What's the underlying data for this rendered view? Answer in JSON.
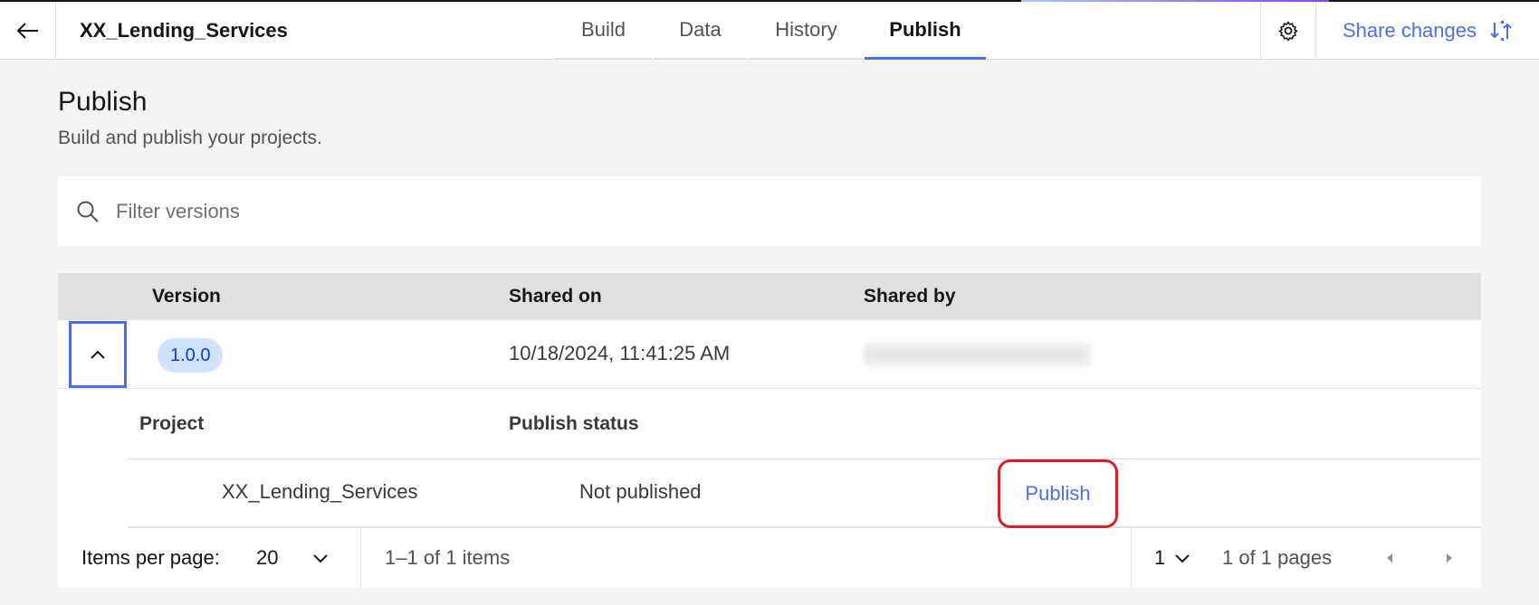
{
  "header": {
    "app_title": "XX_Lending_Services",
    "tabs": [
      {
        "label": "Build"
      },
      {
        "label": "Data"
      },
      {
        "label": "History"
      },
      {
        "label": "Publish"
      }
    ],
    "active_tab": "Publish",
    "share_label": "Share changes",
    "accent_color": "#4a6ef0"
  },
  "page": {
    "title": "Publish",
    "subtitle": "Build and publish your projects."
  },
  "search": {
    "placeholder": "Filter versions",
    "value": ""
  },
  "table": {
    "columns": [
      "Version",
      "Shared on",
      "Shared by"
    ],
    "rows": [
      {
        "version": "1.0.0",
        "shared_on": "10/18/2024, 11:41:25 AM",
        "shared_by": "hidden user",
        "expanded": true
      }
    ],
    "sub_columns": [
      "Project",
      "Publish status"
    ],
    "sub_rows": [
      {
        "project": "XX_Lending_Services",
        "status": "Not published",
        "action": "Publish"
      }
    ]
  },
  "pagination": {
    "items_per_page_label": "Items per page:",
    "items_per_page": "20",
    "range": "1–1 of 1 items",
    "page": "1",
    "pages_label": "1 of 1 pages"
  }
}
